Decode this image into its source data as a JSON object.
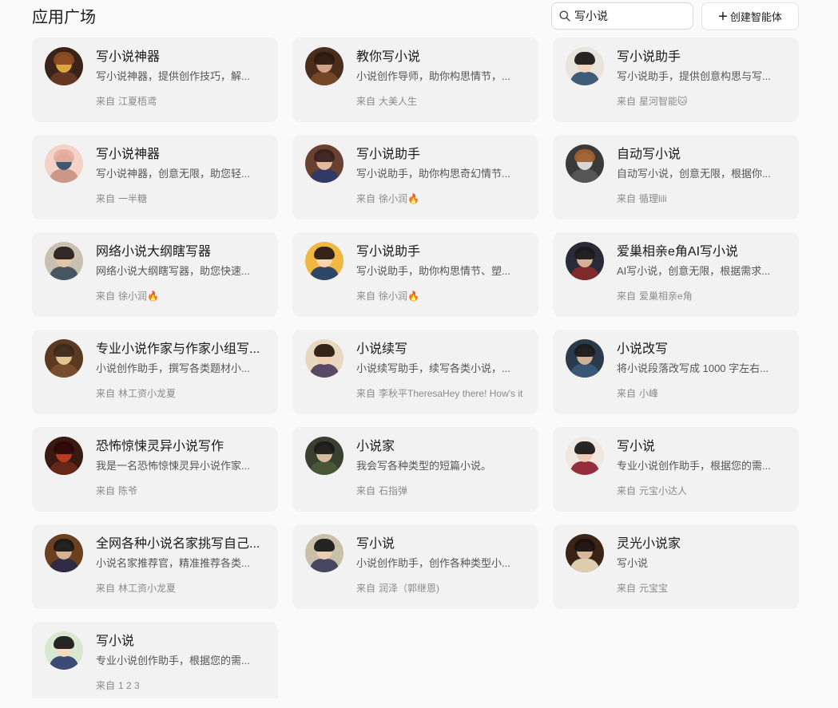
{
  "header": {
    "title": "应用广场",
    "search_value": "写小说",
    "create_label": "创建智能体"
  },
  "from_label": "来自",
  "cards": [
    {
      "title": "写小说神器",
      "desc": "写小说神器，提供创作技巧，解...",
      "author": "江夏梧鸢",
      "bg": "#3a2418",
      "c1": "#f2b544",
      "c2": "#8b4a22",
      "c3": "#6b3a24"
    },
    {
      "title": "教你写小说",
      "desc": "小说创作导师，助你构思情节，...",
      "author": "大美人生",
      "bg": "#4a2e1c",
      "c1": "#e0b090",
      "c2": "#2a1a10",
      "c3": "#7a4a2a"
    },
    {
      "title": "写小说助手",
      "desc": "写小说助手，提供创意构思与写...",
      "author": "星河智能🐱",
      "bg": "#e8e4dc",
      "c1": "#f0d0b8",
      "c2": "#1a1a1a",
      "c3": "#2b4b6b"
    },
    {
      "title": "写小说神器",
      "desc": "写小说神器，创意无限，助您轻...",
      "author": "一半糖",
      "bg": "#f3d3c8",
      "c1": "#2a4a6a",
      "c2": "#e8b0a0",
      "c3": "#c89080"
    },
    {
      "title": "写小说助手",
      "desc": "写小说助手，助你构思奇幻情节...",
      "author": "徐小润🔥",
      "bg": "#6a4030",
      "c1": "#f0c8a8",
      "c2": "#3a2020",
      "c3": "#2a3a6a"
    },
    {
      "title": "自动写小说",
      "desc": "自动写小说，创意无限，根据你...",
      "author": "循理lili",
      "bg": "#3a3a3a",
      "c1": "#e8e8e8",
      "c2": "#a06030",
      "c3": "#5a5a5a"
    },
    {
      "title": "网络小说大纲瞎写器",
      "desc": "网络小说大纲瞎写器，助您快速...",
      "author": "徐小润🔥",
      "bg": "#c8c0b0",
      "c1": "#e8c8a8",
      "c2": "#2a2020",
      "c3": "#3a4a5a"
    },
    {
      "title": "写小说助手",
      "desc": "写小说助手，助你构思情节、塑...",
      "author": "徐小润🔥",
      "bg": "#f0b840",
      "c1": "#f8d8b8",
      "c2": "#2a1a10",
      "c3": "#1a3a6a"
    },
    {
      "title": "爱巢相亲e角AI写小说",
      "desc": "AI写小说，创意无限，根据需求...",
      "author": "爱巢相亲e角",
      "bg": "#2a2a3a",
      "c1": "#e8c0a0",
      "c2": "#1a1a1a",
      "c3": "#8a2a2a"
    },
    {
      "title": "专业小说作家与作家小组写...",
      "desc": "小说创作助手，撰写各类题材小...",
      "author": "林工资小龙夏",
      "bg": "#5a3a20",
      "c1": "#f0d8a0",
      "c2": "#3a2a1a",
      "c3": "#7a5030"
    },
    {
      "title": "小说续写",
      "desc": "小说续写助手，续写各类小说，...",
      "author": "李秋平TheresaHey there! How's it",
      "bg": "#e8d8c0",
      "c1": "#f0d0b0",
      "c2": "#2a1a10",
      "c3": "#4a3a5a"
    },
    {
      "title": "小说改写",
      "desc": "将小说段落改写成 1000 字左右...",
      "author": "小峰",
      "bg": "#2a3a4a",
      "c1": "#e0c0a0",
      "c2": "#1a1a1a",
      "c3": "#3a5a7a"
    },
    {
      "title": "恐怖惊悚灵异小说写作",
      "desc": "我是一名恐怖惊悚灵异小说作家...",
      "author": "陈爷",
      "bg": "#3a1a10",
      "c1": "#c84020",
      "c2": "#2a0a0a",
      "c3": "#6a2a1a"
    },
    {
      "title": "小说家",
      "desc": "我会写各种类型的短篇小说。",
      "author": "石指弹",
      "bg": "#3a4030",
      "c1": "#e8c8a8",
      "c2": "#1a1a1a",
      "c3": "#4a5a3a"
    },
    {
      "title": "写小说",
      "desc": "专业小说创作助手，根据您的需...",
      "author": "元宝小达人",
      "bg": "#f0e8e0",
      "c1": "#f0c8b0",
      "c2": "#1a1a1a",
      "c3": "#8a1a2a"
    },
    {
      "title": "全网各种小说名家挑写自己...",
      "desc": "小说名家推荐官，精准推荐各类...",
      "author": "林工资小龙夏",
      "bg": "#6a4020",
      "c1": "#e0c0a0",
      "c2": "#1a1a1a",
      "c3": "#2a2a4a"
    },
    {
      "title": "写小说",
      "desc": "小说创作助手，创作各种类型小...",
      "author": "润泽（郭继恩)",
      "bg": "#c8c0a8",
      "c1": "#f0d0b0",
      "c2": "#1a1a1a",
      "c3": "#3a3a5a"
    },
    {
      "title": "灵光小说家",
      "desc": "写小说",
      "author": "元宝宝",
      "bg": "#3a2418",
      "c1": "#e8c8a8",
      "c2": "#1a1010",
      "c3": "#f0e0c0"
    },
    {
      "title": "写小说",
      "desc": "专业小说创作助手，根据您的需...",
      "author": "1 2 3",
      "bg": "#d8e8d0",
      "c1": "#f8d8c0",
      "c2": "#1a1a1a",
      "c3": "#2a3a6a"
    }
  ]
}
